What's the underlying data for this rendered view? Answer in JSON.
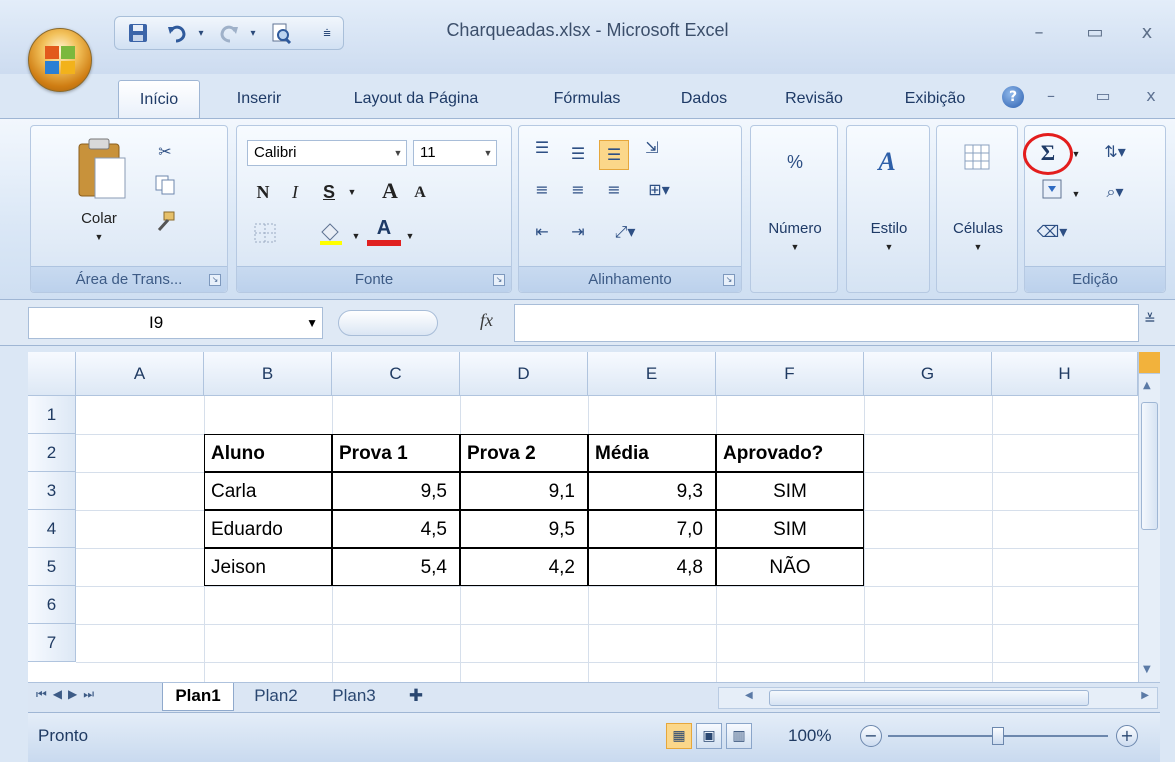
{
  "window": {
    "title": "Charqueadas.xlsx - Microsoft Excel",
    "controls": {
      "minimize": "–",
      "maximize": "▭",
      "close": "x"
    },
    "doc_controls": {
      "minimize": "–",
      "restore": "▭",
      "close": "x"
    }
  },
  "quick_access": [
    "save-icon",
    "undo-icon",
    "redo-icon",
    "print-preview-icon"
  ],
  "tabs": [
    "Início",
    "Inserir",
    "Layout da Página",
    "Fórmulas",
    "Dados",
    "Revisão",
    "Exibição"
  ],
  "active_tab": "Início",
  "ribbon": {
    "clipboard": {
      "label": "Área de Trans...",
      "paste": "Colar"
    },
    "font": {
      "label": "Fonte",
      "family": "Calibri",
      "size": "11",
      "bold": "N",
      "italic": "I",
      "underline": "S",
      "grow": "A",
      "shrink": "A",
      "font_color_letter": "A"
    },
    "alignment": {
      "label": "Alinhamento"
    },
    "number": {
      "label": "Número",
      "symbol": "%"
    },
    "styles": {
      "label": "Estilo"
    },
    "cells": {
      "label": "Células"
    },
    "editing": {
      "label": "Edição",
      "autosum": "Σ"
    }
  },
  "formula_bar": {
    "name_box": "I9",
    "fx": "fx",
    "value": ""
  },
  "columns": [
    "A",
    "B",
    "C",
    "D",
    "E",
    "F",
    "G",
    "H"
  ],
  "rows": [
    "1",
    "2",
    "3",
    "4",
    "5",
    "6",
    "7"
  ],
  "table": {
    "headers": [
      "Aluno",
      "Prova 1",
      "Prova 2",
      "Média",
      "Aprovado?"
    ],
    "rows": [
      [
        "Carla",
        "9,5",
        "9,1",
        "9,3",
        "SIM"
      ],
      [
        "Eduardo",
        "4,5",
        "9,5",
        "7,0",
        "SIM"
      ],
      [
        "Jeison",
        "5,4",
        "4,2",
        "4,8",
        "NÃO"
      ]
    ]
  },
  "sheets": [
    "Plan1",
    "Plan2",
    "Plan3"
  ],
  "active_sheet": "Plan1",
  "status": {
    "text": "Pronto",
    "zoom": "100%",
    "zoom_level": 1.0
  },
  "colors": {
    "highlight_circle": "#e31d1d",
    "ribbon_bg": "#dae7f6"
  }
}
